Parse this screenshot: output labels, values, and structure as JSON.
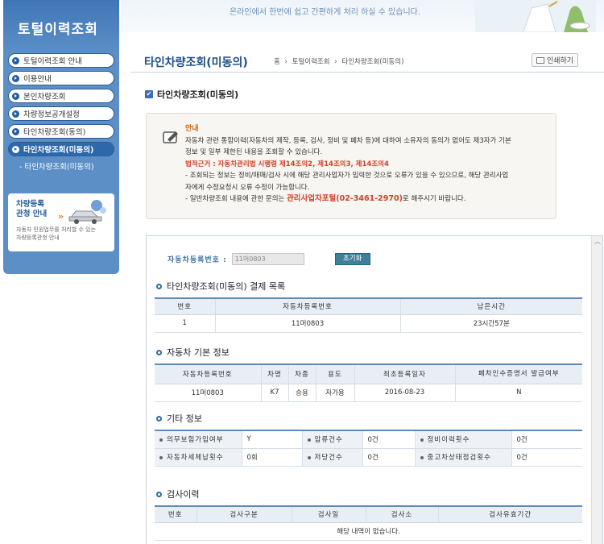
{
  "banner": {
    "slogan": "온라인에서 한번에 쉽고 간편하게 처리 하실 수 있습니다."
  },
  "sidebar": {
    "title": "토털이력조회",
    "items": [
      {
        "label": "토털이력조회 안내",
        "active": false
      },
      {
        "label": "이용안내",
        "active": false
      },
      {
        "label": "본인차량조회",
        "active": false
      },
      {
        "label": "차량정보공개설정",
        "active": false
      },
      {
        "label": "타인차량조회(동의)",
        "active": false
      },
      {
        "label": "타인차량조회(미동의)",
        "active": true
      }
    ],
    "submenu": "- 타인차량조회(미동의)",
    "promo": {
      "title_line1": "차량등록",
      "title_line2": "관청 안내",
      "arrow": "»",
      "desc_line1": "자동차 민원업무를 처리할 수 있는",
      "desc_line2": "차량등록관청 안내"
    }
  },
  "page": {
    "title": "타인차량조회(미동의)",
    "breadcrumb": [
      "홈",
      "›",
      "토털이력조회",
      "›",
      "타인차량조회(미동의)"
    ],
    "print_label": "인쇄하기",
    "section_title": "타인차량조회(미동의)"
  },
  "notice": {
    "title": "안내",
    "line1": "자동차 관련 통합이력(자동차의 제작, 등록, 검사, 정비 및 폐차 등)에 대하여 소유자의 동의가 없어도 제3자가 기본",
    "line2": "정보 및 일부 제한된 내용을 조회할 수 있습니다.",
    "law": "법적근거 : 자동차관리법 시행령 제14조의2, 제14조의3, 제14조의4",
    "line3": "- 조회되는 정보는 정비/매매/검사 시에 해당 관리사업자가 입력한 것으로 오류가 있을 수 있으므로, 해당 관리사업",
    "line4": "자에게 수정요청시 오류 수정이 가능합니다.",
    "line5a": "- 일반차량조회 내용에 관한 문의는",
    "line5b": "관리사업자포털(02-3461-2970)",
    "line5c": "로 해주시기 바랍니다."
  },
  "search": {
    "label": "자동차등록번호 :",
    "value": "11머0803",
    "reset_label": "초기화"
  },
  "payment": {
    "title": "타인차량조회(미동의) 결제 목록",
    "headers": [
      "번호",
      "자동차등록번호",
      "남은시간"
    ],
    "rows": [
      [
        "1",
        "11머0803",
        "23시간57분"
      ]
    ]
  },
  "basic": {
    "title": "자동차 기본 정보",
    "headers": [
      "자동차등록번호",
      "차명",
      "차종",
      "용도",
      "최초등록일자",
      "폐차인수증명서 발급여부"
    ],
    "rows": [
      [
        "11머0803",
        "K7",
        "승용",
        "자가용",
        "2016-08-23",
        "N"
      ]
    ]
  },
  "etc": {
    "title": "기타 정보",
    "row1": {
      "l1": "의무보험가입여부",
      "v1": "Y",
      "l2": "압류건수",
      "v2": "0건",
      "l3": "정비이력횟수",
      "v3": "0건"
    },
    "row2": {
      "l1": "자동차세체납횟수",
      "v1": "0회",
      "l2": "저당건수",
      "v2": "0건",
      "l3": "중고차상태점검횟수",
      "v3": "0건"
    }
  },
  "inspection": {
    "title": "검사이력",
    "headers": [
      "번호",
      "검사구분",
      "검사일",
      "검사소",
      "검사유효기간"
    ],
    "empty": "해당 내역이 없습니다."
  },
  "colors": {
    "accent": "#1f4e8c",
    "sidebar": "#5b8fc6",
    "notice_title": "#d76511",
    "highlight": "#d2402b"
  }
}
